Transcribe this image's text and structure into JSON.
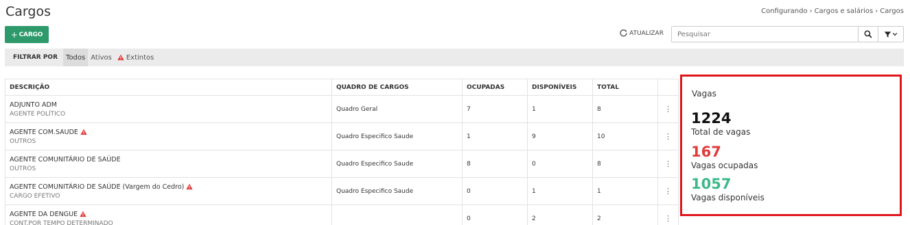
{
  "page_title": "Cargos",
  "breadcrumb": [
    "Configurando",
    "Cargos e salários",
    "Cargos"
  ],
  "toolbar": {
    "add_label": "CARGO",
    "refresh_label": "ATUALIZAR",
    "search_placeholder": "Pesquisar"
  },
  "filter": {
    "label": "FILTRAR POR",
    "tabs": [
      {
        "label": "Todos",
        "active": true,
        "warn": false
      },
      {
        "label": "Ativos",
        "active": false,
        "warn": false
      },
      {
        "label": "Extintos",
        "active": false,
        "warn": true
      }
    ]
  },
  "table": {
    "headers": [
      "DESCRIÇÃO",
      "QUADRO DE CARGOS",
      "OCUPADAS",
      "DISPONÍVEIS",
      "TOTAL"
    ],
    "rows": [
      {
        "descricao": "ADJUNTO ADM",
        "tipo": "AGENTE POLÍTICO",
        "quadro": "Quadro Geral",
        "ocupadas": "7",
        "disponiveis": "1",
        "total": "8",
        "warn": false
      },
      {
        "descricao": "AGENTE COM.SAUDE",
        "tipo": "OUTROS",
        "quadro": "Quadro Especifico Saude",
        "ocupadas": "1",
        "disponiveis": "9",
        "total": "10",
        "warn": true
      },
      {
        "descricao": "AGENTE COMUNITÁRIO DE SAÚDE",
        "tipo": "OUTROS",
        "quadro": "Quadro Especifico Saude",
        "ocupadas": "8",
        "disponiveis": "0",
        "total": "8",
        "warn": false
      },
      {
        "descricao": "AGENTE COMUNITÁRIO DE SAÚDE (Vargem do Cedro)",
        "tipo": "CARGO EFETIVO",
        "quadro": "Quadro Especifico Saude",
        "ocupadas": "0",
        "disponiveis": "1",
        "total": "1",
        "warn": true
      },
      {
        "descricao": "AGENTE DA DENGUE",
        "tipo": "CONT.POR TEMPO DETERMINADO",
        "quadro": "",
        "ocupadas": "0",
        "disponiveis": "2",
        "total": "2",
        "warn": true
      }
    ]
  },
  "vagas": {
    "title": "Vagas",
    "total": {
      "value": "1224",
      "label": "Total de vagas",
      "color": "#111111"
    },
    "ocupadas": {
      "value": "167",
      "label": "Vagas ocupadas",
      "color": "#e03c3c"
    },
    "disponiveis": {
      "value": "1057",
      "label": "Vagas disponíveis",
      "color": "#3cb98a"
    }
  },
  "colors": {
    "accent": "#2e9a6b",
    "highlight_border": "#e0151b",
    "warn": "#e03c3c"
  }
}
